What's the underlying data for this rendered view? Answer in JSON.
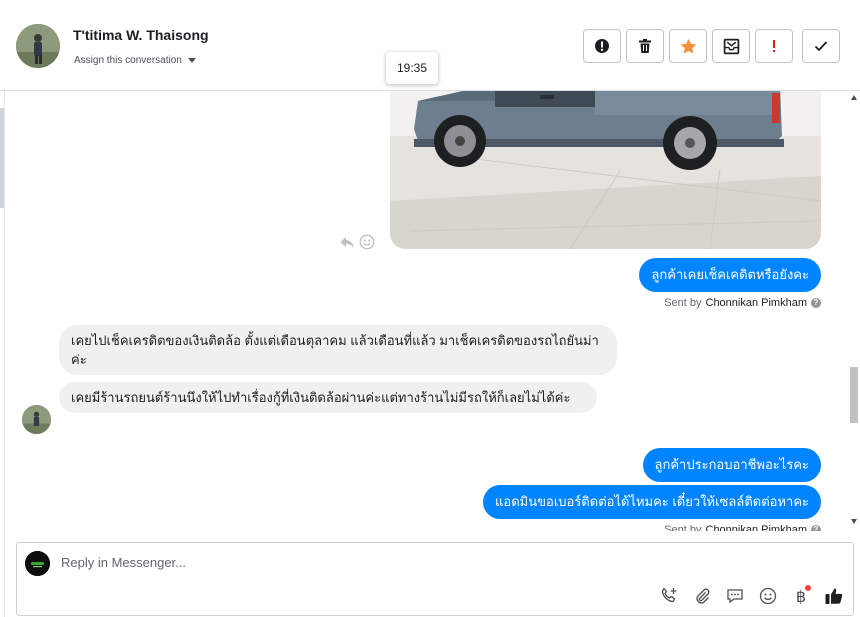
{
  "header": {
    "contact_name": "T'titima W. Thaisong",
    "assign_label": "Assign this conversation",
    "toolbar": [
      {
        "icon": "alert-circle-icon"
      },
      {
        "icon": "trash-icon"
      },
      {
        "icon": "star-icon"
      },
      {
        "icon": "archive-mail-icon"
      },
      {
        "icon": "exclamation-icon"
      },
      {
        "icon": "check-icon"
      }
    ]
  },
  "tooltip": {
    "time": "19:35"
  },
  "messages": {
    "out_1": {
      "text": "ลูกค้าเคยเช็คเคดิตหรือยังคะ"
    },
    "sent_by_prefix": "Sent by",
    "sent_by_name": "Chonnikan Pimkham",
    "in_1": {
      "text": "เคยไปเช็คเครดิตของเงินติดล้อ ตั้งแต่เดือนตุลาคม แล้วเดือนที่แล้ว มาเช็คเครดิตของรถไถยันม่าค่ะ"
    },
    "in_2": {
      "text": "เคยมีร้านรถยนต์ร้านนึงให้ไปทำเรื่องกู้ที่เงินติดล้อผ่านค่ะแต่ทางร้านไม่มีรถให้ก็เลยไม่ได้ค่ะ"
    },
    "out_2": {
      "text": "ลูกค้าประกอบอาชีพอะไรคะ"
    },
    "out_3": {
      "text": "แอดมินขอเบอร์ติดต่อได้ไหมคะ เดี๋ยวให้เซลล์ติดต่อหาคะ"
    }
  },
  "composer": {
    "placeholder": "Reply in Messenger...",
    "icons": [
      "add-call-icon",
      "attachment-icon",
      "saved-reply-icon",
      "emoji-icon",
      "baht-payment-icon",
      "thumbs-up-icon"
    ]
  },
  "colors": {
    "accent_blue": "#0084ff",
    "incoming_bubble": "#f0f0f0",
    "star_orange": "#f7923a",
    "alert_red": "#fa3e3e"
  }
}
